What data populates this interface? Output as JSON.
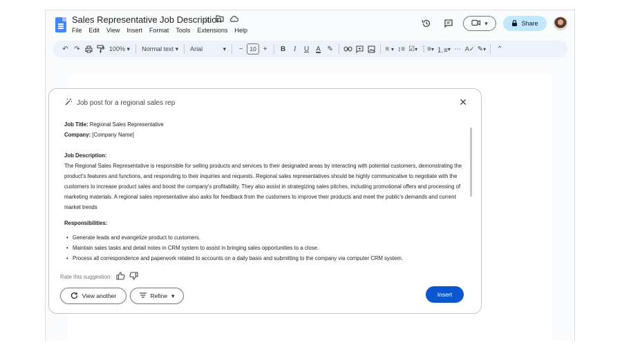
{
  "app": {
    "doc_title": "Sales Representative Job Description",
    "menu": [
      "File",
      "Edit",
      "View",
      "Insert",
      "Format",
      "Tools",
      "Extensions",
      "Help"
    ],
    "share_label": "Share"
  },
  "toolbar": {
    "zoom": "100%",
    "style": "Normal text",
    "font": "Arial",
    "font_size": "10",
    "bold": "B",
    "italic": "I",
    "underline": "U",
    "text_color": "A"
  },
  "panel": {
    "prompt": "Job post for a regional sales rep",
    "job_title_label": "Job Title:",
    "job_title_value": "Regional Sales Representative",
    "company_label": "Company:",
    "company_value": "[Company Name]",
    "description_heading": "Job Description:",
    "description_text": "The Regional Sales Representative is responsible for selling products and services to their designated areas by interacting with potential customers, demonstrating the product's features and functions, and responding to their inquiries and requests. Regional sales representatives should be highly communicative to negotiate with the customers to increase product sales and boost the company's profitability. They also assist in strategizing sales pitches, including promotional offers and processing of marketing materials. A regional sales representative also asks for feedback from the customers to improve their products and meet the public's demands and current market trends",
    "responsibilities_heading": "Responsibilities:",
    "responsibilities": [
      "Generate leads and evangelize product to customers.",
      "Maintain sales tasks and detail notes in CRM system to assist in bringing sales opportunities to a close.",
      "Process all correspondence and paperwork related to accounts on a daily basis and submitting to the company via computer CRM system."
    ],
    "rate_label": "Rate this suggestion:",
    "view_another_label": "View another",
    "refine_label": "Refine",
    "insert_label": "Insert"
  },
  "colors": {
    "accent": "#0b57d0",
    "share_bg": "#c2e7ff",
    "toolbar_bg": "#edf2fa"
  }
}
